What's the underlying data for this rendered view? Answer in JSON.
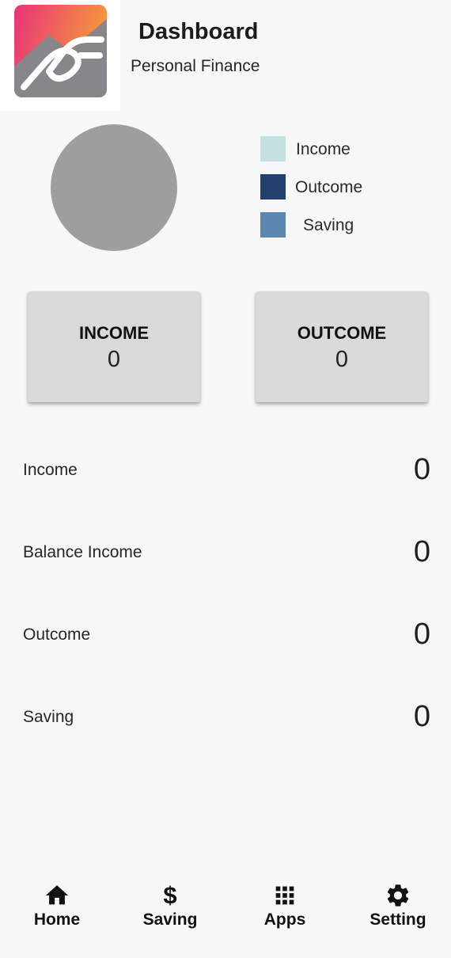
{
  "header": {
    "title": "Dashboard",
    "subtitle": "Personal Finance"
  },
  "legend": [
    {
      "label": "Income",
      "color": "#c5e0e3"
    },
    {
      "label": "Outcome",
      "color": "#243f6e"
    },
    {
      "label": "Saving",
      "color": "#5b87b0"
    }
  ],
  "pie": {
    "color": "#9e9e9e"
  },
  "cards": [
    {
      "title": "INCOME",
      "value": "0"
    },
    {
      "title": "OUTCOME",
      "value": "0"
    }
  ],
  "rows": [
    {
      "label": "Income",
      "value": "0"
    },
    {
      "label": "Balance Income",
      "value": "0"
    },
    {
      "label": "Outcome",
      "value": "0"
    },
    {
      "label": "Saving",
      "value": "0"
    }
  ],
  "nav": [
    {
      "label": "Home",
      "icon": "home-icon"
    },
    {
      "label": "Saving",
      "icon": "dollar-icon",
      "glyph": "$"
    },
    {
      "label": "Apps",
      "icon": "apps-grid-icon"
    },
    {
      "label": "Setting",
      "icon": "gear-icon"
    }
  ]
}
